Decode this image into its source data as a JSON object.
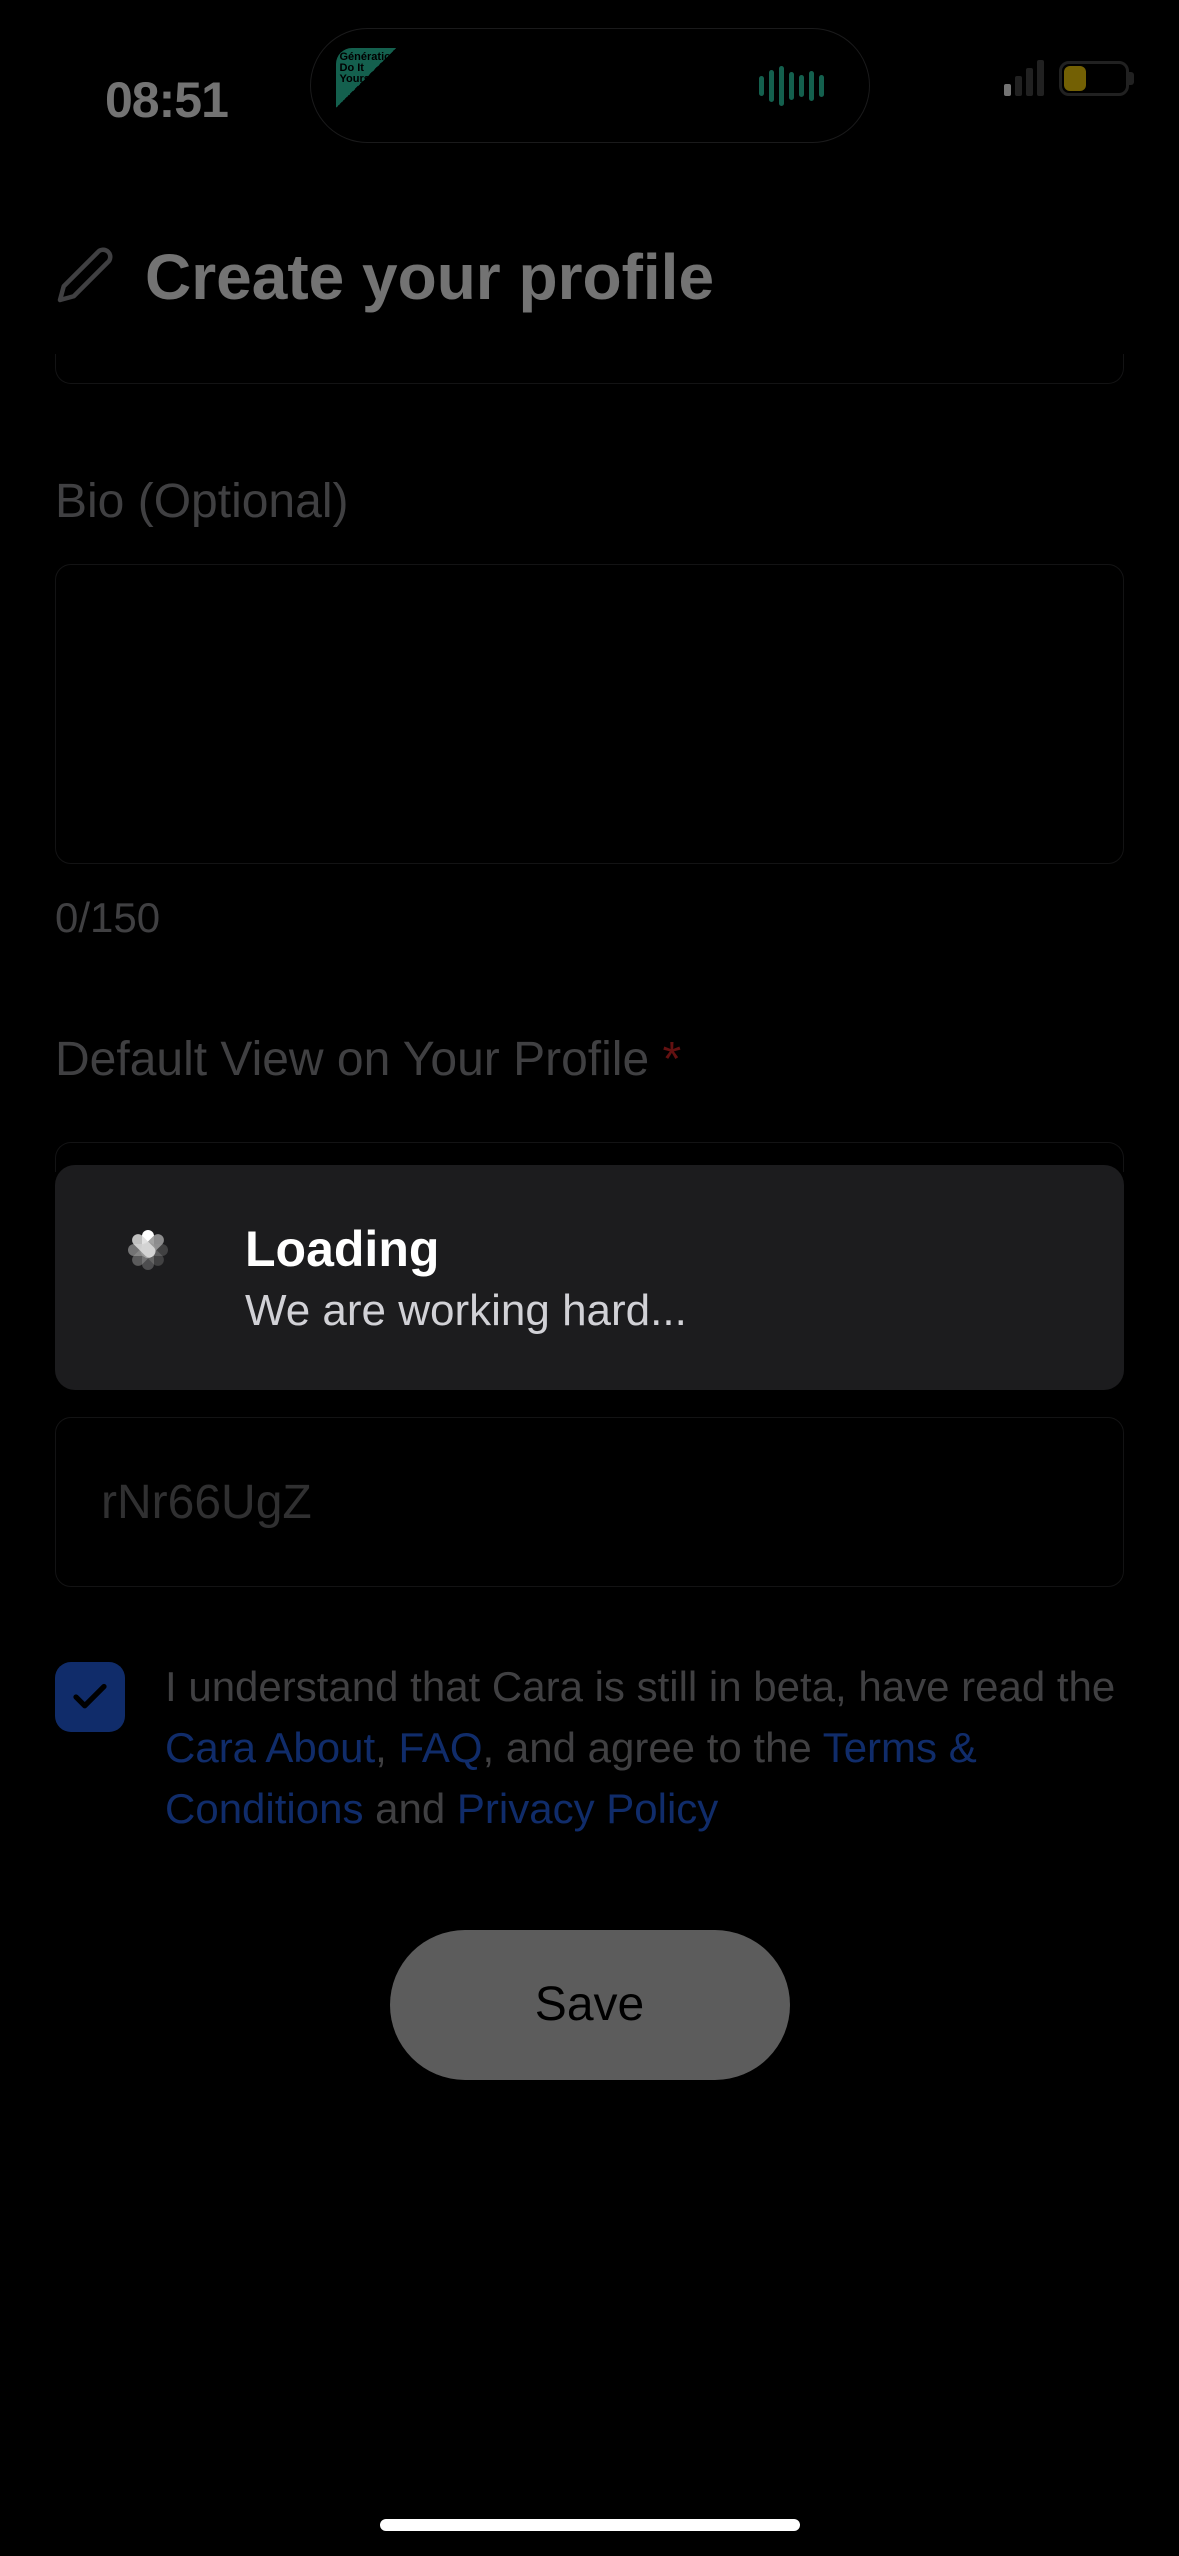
{
  "status_bar": {
    "time": "08:51"
  },
  "header": {
    "title": "Create your profile"
  },
  "form": {
    "bio_label": "Bio (Optional)",
    "char_count": "0/150",
    "default_view_label": "Default View on Your Profile ",
    "asterisk": "*",
    "text_input_value": "rNr66UgZ"
  },
  "agreement": {
    "part1": "I understand that Cara is still in beta, have read the ",
    "link1": "Cara About",
    "comma": ", ",
    "link2": "FAQ",
    "part2": ", and agree to the ",
    "link3": "Terms & Conditions",
    "and": " and ",
    "link4": "Privacy Policy"
  },
  "save_button": "Save",
  "toast": {
    "title": "Loading",
    "subtitle": "We are working hard..."
  }
}
